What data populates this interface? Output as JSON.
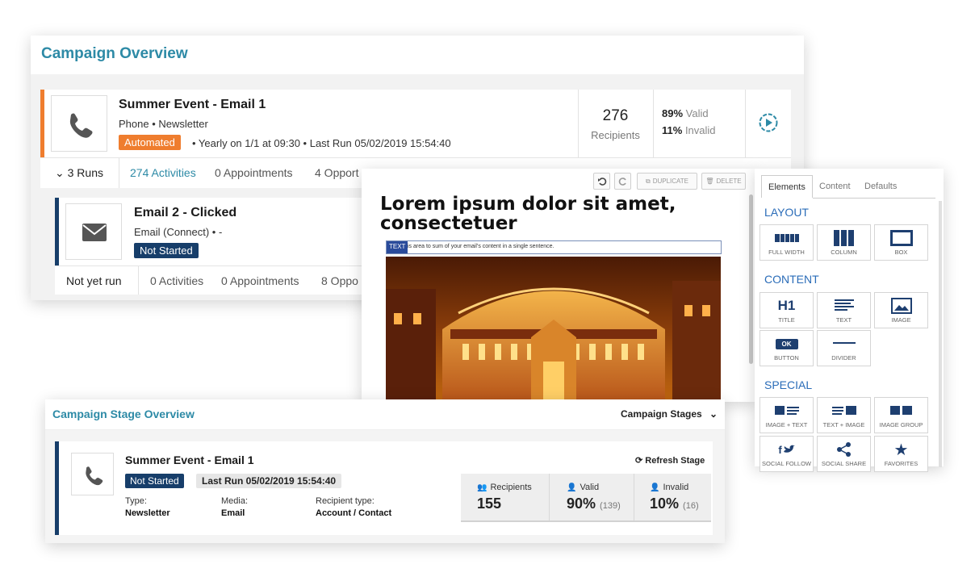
{
  "overview": {
    "title": "Campaign Overview",
    "item1": {
      "title": "Summer Event - Email 1",
      "meta": "Phone  • Newsletter",
      "status": "Automated",
      "schedule": "• Yearly on 1/1 at 09:30  • Last Run 05/02/2019 15:54:40",
      "recipients_count": "276",
      "recipients_label": "Recipients",
      "valid_pct": "89%",
      "valid_label": "Valid",
      "invalid_pct": "11%",
      "invalid_label": "Invalid",
      "runs": "3 Runs",
      "activities": "274 Activities",
      "appointments": "0 Appointments",
      "opportunities": "4 Opport"
    },
    "item2": {
      "title": "Email 2 - Clicked",
      "meta": "Email (Connect)  • -",
      "status": "Not Started",
      "runs": "Not yet run",
      "activities": "0 Activities",
      "appointments": "0 Appointments",
      "opportunities": "8 Oppo"
    }
  },
  "editor": {
    "toolbar": {
      "duplicate": "DUPLICATE",
      "delete": "DELETE"
    },
    "heading": "Lorem ipsum dolor sit amet, consectetuer",
    "text_tag": "TEXT",
    "text_line": "is area to sum of your email's content in a single sentence."
  },
  "panel": {
    "tabs": [
      "Elements",
      "Content",
      "Defaults"
    ],
    "layout_title": "LAYOUT",
    "layout": [
      "FULL WIDTH",
      "COLUMN",
      "BOX"
    ],
    "content_title": "CONTENT",
    "content": [
      "TITLE",
      "TEXT",
      "IMAGE",
      "BUTTON",
      "DIVIDER"
    ],
    "h1_glyph": "H1",
    "ok_glyph": "OK",
    "special_title": "SPECIAL",
    "special": [
      "IMAGE + TEXT",
      "TEXT + IMAGE",
      "IMAGE GROUP",
      "SOCIAL FOLLOW",
      "SOCIAL SHARE",
      "FAVORITES"
    ]
  },
  "stage": {
    "title": "Campaign Stage Overview",
    "dropdown": "Campaign Stages",
    "card": {
      "title": "Summer Event - Email 1",
      "refresh": "Refresh Stage",
      "status": "Not Started",
      "last_run": "Last Run 05/02/2019 15:54:40",
      "type_label": "Type:",
      "type_value": "Newsletter",
      "media_label": "Media:",
      "media_value": "Email",
      "rtype_label": "Recipient type:",
      "rtype_value": "Account / Contact",
      "recipients_label": "Recipients",
      "recipients_value": "155",
      "valid_label": "Valid",
      "valid_value": "90%",
      "valid_count": "(139)",
      "invalid_label": "Invalid",
      "invalid_value": "10%",
      "invalid_count": "(16)"
    }
  },
  "colors": {
    "accent_teal": "#2d8aa6",
    "orange": "#ef7d2e",
    "navy": "#173e6a",
    "blue": "#2a6cb8"
  }
}
